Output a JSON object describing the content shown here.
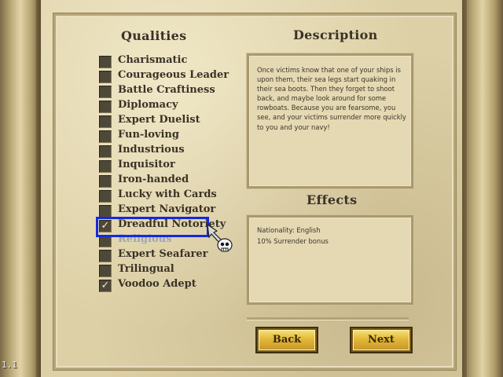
{
  "headings": {
    "qualities": "Qualities",
    "description": "Description",
    "effects": "Effects"
  },
  "qualities": [
    {
      "label": "Charismatic",
      "checked": false,
      "enabled": true
    },
    {
      "label": "Courageous Leader",
      "checked": false,
      "enabled": true
    },
    {
      "label": "Battle Craftiness",
      "checked": false,
      "enabled": true
    },
    {
      "label": "Diplomacy",
      "checked": false,
      "enabled": true
    },
    {
      "label": "Expert Duelist",
      "checked": false,
      "enabled": true
    },
    {
      "label": "Fun-loving",
      "checked": false,
      "enabled": true
    },
    {
      "label": "Industrious",
      "checked": false,
      "enabled": true
    },
    {
      "label": "Inquisitor",
      "checked": false,
      "enabled": true
    },
    {
      "label": "Iron-handed",
      "checked": false,
      "enabled": true
    },
    {
      "label": "Lucky with Cards",
      "checked": false,
      "enabled": true
    },
    {
      "label": "Expert Navigator",
      "checked": false,
      "enabled": true
    },
    {
      "label": "Dreadful Notoriety",
      "checked": true,
      "enabled": true,
      "selected": true
    },
    {
      "label": "Religious",
      "checked": false,
      "enabled": false
    },
    {
      "label": "Expert Seafarer",
      "checked": false,
      "enabled": true
    },
    {
      "label": "Trilingual",
      "checked": false,
      "enabled": true
    },
    {
      "label": "Voodoo Adept",
      "checked": true,
      "enabled": true
    }
  ],
  "check_mark": "✓",
  "description_text": "Once victims know that one of your ships is upon them, their sea legs start quaking in their sea boots.  Then they forget to shoot back, and maybe look around for some rowboats.  Because you are fearsome, you see, and your victims surrender more quickly to you and your navy!",
  "effects_lines": [
    "Nationality: English",
    "10% Surrender bonus"
  ],
  "buttons": {
    "back": "Back",
    "next": "Next"
  },
  "corner_text": "1.1",
  "colors": {
    "highlight": "#1329e0",
    "disabled_text": "#9aa6ba",
    "button_gold": "#e2b93a"
  }
}
